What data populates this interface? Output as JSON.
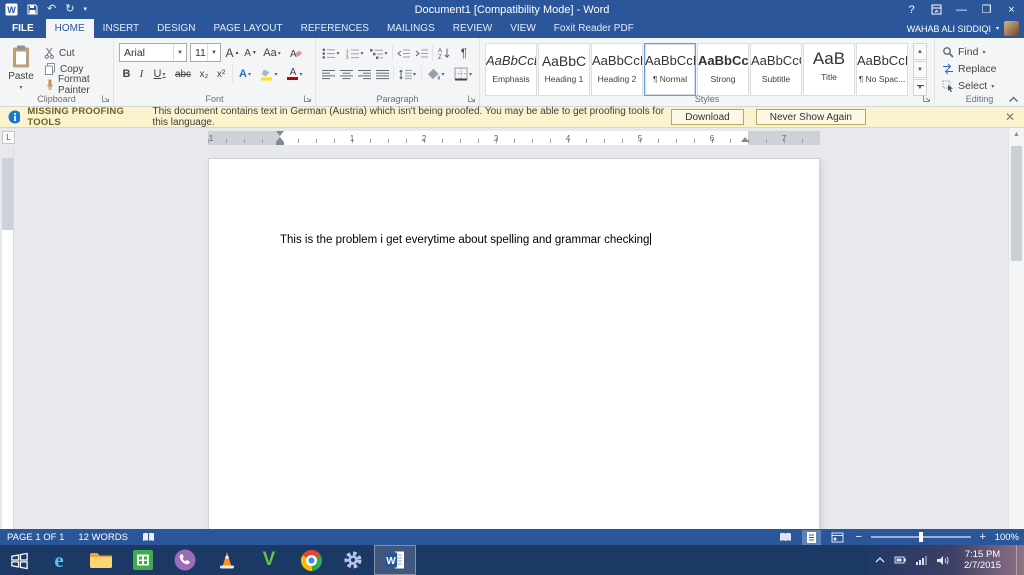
{
  "window": {
    "title": "Document1 [Compatibility Mode] - Word"
  },
  "quick_access": {
    "icons": [
      "word-logo",
      "save",
      "undo",
      "redo",
      "customize"
    ]
  },
  "tabs": {
    "items": [
      {
        "label": "FILE"
      },
      {
        "label": "HOME"
      },
      {
        "label": "INSERT"
      },
      {
        "label": "DESIGN"
      },
      {
        "label": "PAGE LAYOUT"
      },
      {
        "label": "REFERENCES"
      },
      {
        "label": "MAILINGS"
      },
      {
        "label": "REVIEW"
      },
      {
        "label": "VIEW"
      },
      {
        "label": "Foxit Reader PDF"
      }
    ],
    "active_tab": "HOME",
    "user_name": "WAHAB ALI SIDDIQI"
  },
  "ribbon": {
    "clipboard": {
      "group_label": "Clipboard",
      "paste": "Paste",
      "cut": "Cut",
      "copy": "Copy",
      "format_painter": "Format Painter"
    },
    "font": {
      "group_label": "Font",
      "name": "Arial",
      "size": "11",
      "grow": "A",
      "shrink": "A",
      "change_case": "Aa",
      "bold": "B",
      "italic": "I",
      "underline": "U",
      "strikethrough": "abc",
      "subscript": "x₂",
      "superscript": "x²",
      "effects": "A",
      "font_color": "A"
    },
    "paragraph": {
      "group_label": "Paragraph"
    },
    "styles": {
      "group_label": "Styles",
      "items": [
        {
          "preview": "AaBbCcL",
          "name": "Emphasis"
        },
        {
          "preview": "AaBbC",
          "name": "Heading 1"
        },
        {
          "preview": "AaBbCcI",
          "name": "Heading 2"
        },
        {
          "preview": "AaBbCcI",
          "name": "¶ Normal"
        },
        {
          "preview": "AaBbCcI",
          "name": "Strong"
        },
        {
          "preview": "AaBbCcC",
          "name": "Subtitle"
        },
        {
          "preview": "AaB",
          "name": "Title"
        },
        {
          "preview": "AaBbCcI",
          "name": "¶ No Spac..."
        }
      ],
      "selected": "¶ Normal"
    },
    "editing": {
      "group_label": "Editing",
      "find": "Find",
      "replace": "Replace",
      "select": "Select"
    }
  },
  "proofing_banner": {
    "title": "MISSING PROOFING TOOLS",
    "message": "This document contains text in German (Austria) which isn't being proofed. You may be able to get proofing tools for this language.",
    "download": "Download",
    "never_show": "Never Show Again"
  },
  "ruler": {
    "numbers": [
      "1",
      "1",
      "2",
      "3",
      "4",
      "5",
      "6",
      "7"
    ]
  },
  "document": {
    "text": "This is the problem i get everytime about spelling and grammar checking"
  },
  "status_bar": {
    "page": "PAGE 1 OF 1",
    "words": "12 WORDS",
    "minus": "−",
    "plus": "+",
    "zoom": "100%"
  },
  "taskbar": {
    "pinned_icons": [
      "internet-explorer",
      "file-explorer",
      "store",
      "viber",
      "vlc",
      "v-player",
      "chrome",
      "settings",
      "word"
    ],
    "tray_icons": [
      "expand",
      "battery",
      "network",
      "volume"
    ],
    "time": "7:15 PM",
    "date": "2/7/2015"
  },
  "colors": {
    "accent": "#2b579a",
    "banner_bg": "#fbf3ce",
    "heading_style": "#2e74b5"
  }
}
